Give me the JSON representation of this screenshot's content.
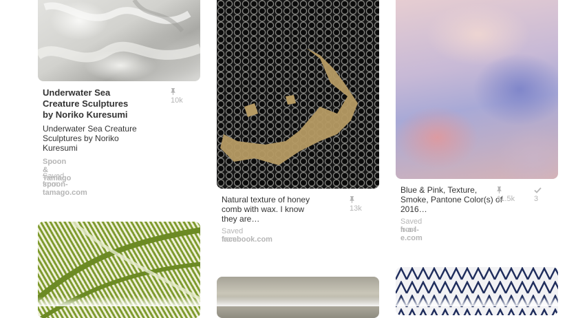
{
  "pins": [
    {
      "title": "Underwater Sea Creature Sculptures by Noriko Kuresumi",
      "title_lines": [
        "Underwater Sea",
        "Creature Sculptures",
        "by Noriko Kuresumi"
      ],
      "repins": "10k",
      "description_lines": [
        "Underwater Sea Creature",
        "Sculptures by Noriko",
        "Kuresumi"
      ],
      "pinner": "Spoon & Tamago",
      "saved_from_label": "Saved from",
      "source": "spoon-tamago.com"
    },
    {
      "description_lines": [
        "Natural texture of honey",
        "comb with wax. I know",
        "they are…"
      ],
      "repins": "13k",
      "saved_from_label": "Saved from",
      "source": "facebook.com"
    },
    {
      "description_lines": [
        "Blue & Pink, Texture,",
        "Smoke, Pantone Color(s) of",
        "2016…"
      ],
      "repins": "11.5k",
      "likes": "3",
      "saved_from_label": "Saved from",
      "source": "h-a-l-e.com"
    }
  ],
  "icons": {
    "repin": "pushpin-icon",
    "like": "checkmark-icon"
  },
  "colors": {
    "meta_gray": "#b5b5b5",
    "text": "#333333"
  }
}
